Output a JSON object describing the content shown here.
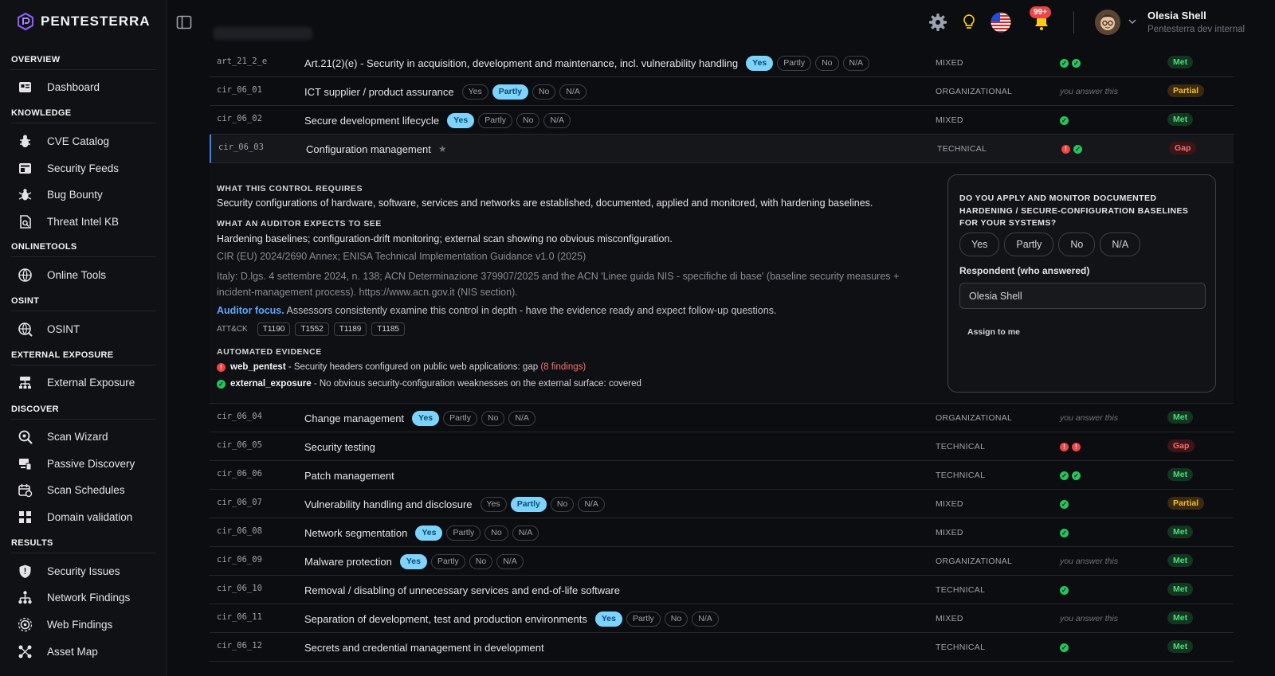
{
  "app": {
    "name": "PENTESTERRA"
  },
  "sidebar": {
    "sections": [
      {
        "title": "OVERVIEW",
        "items": [
          {
            "label": "Dashboard",
            "icon": "dashboard-icon"
          }
        ]
      },
      {
        "title": "KNOWLEDGE",
        "items": [
          {
            "label": "CVE Catalog",
            "icon": "bug-icon"
          },
          {
            "label": "Security Feeds",
            "icon": "news-icon"
          },
          {
            "label": "Bug Bounty",
            "icon": "bug-bounty-icon"
          },
          {
            "label": "Threat Intel KB",
            "icon": "document-search-icon"
          }
        ]
      },
      {
        "title": "ONLINETOOLS",
        "items": [
          {
            "label": "Online Tools",
            "icon": "globe-icon"
          }
        ]
      },
      {
        "title": "OSINT",
        "items": [
          {
            "label": "OSINT",
            "icon": "osint-globe-icon"
          }
        ]
      },
      {
        "title": "EXTERNAL EXPOSURE",
        "items": [
          {
            "label": "External Exposure",
            "icon": "network-icon"
          }
        ]
      },
      {
        "title": "DISCOVER",
        "items": [
          {
            "label": "Scan Wizard",
            "icon": "radar-icon"
          },
          {
            "label": "Passive Discovery",
            "icon": "devices-icon"
          },
          {
            "label": "Scan Schedules",
            "icon": "calendar-icon"
          },
          {
            "label": "Domain validation",
            "icon": "domain-icon"
          }
        ]
      },
      {
        "title": "RESULTS",
        "items": [
          {
            "label": "Security Issues",
            "icon": "shield-icon"
          },
          {
            "label": "Network Findings",
            "icon": "tree-icon"
          },
          {
            "label": "Web Findings",
            "icon": "web-icon"
          },
          {
            "label": "Asset Map",
            "icon": "map-icon"
          }
        ]
      }
    ]
  },
  "topbar": {
    "notifications": "99+",
    "user": {
      "name": "Olesia Shell",
      "org": "Pentesterra dev internal"
    },
    "language": "en-US"
  },
  "rows_before": [
    {
      "code": "art_21_2_e",
      "name": "Art.21(2)(e) - Security in acquisition, development and maintenance, incl. vulnerability handling",
      "options": [
        "Yes",
        "Partly",
        "No",
        "N/A"
      ],
      "selected": "Yes",
      "type": "MIXED",
      "evidence": [
        "ok",
        "ok"
      ],
      "answer": "",
      "status": "Met"
    },
    {
      "code": "cir_06_01",
      "name": "ICT supplier / product assurance",
      "options": [
        "Yes",
        "Partly",
        "No",
        "N/A"
      ],
      "selected": "Partly",
      "type": "ORGANIZATIONAL",
      "evidence": [],
      "answer": "you answer this",
      "status": "Partial"
    },
    {
      "code": "cir_06_02",
      "name": "Secure development lifecycle",
      "options": [
        "Yes",
        "Partly",
        "No",
        "N/A"
      ],
      "selected": "Yes",
      "type": "MIXED",
      "evidence": [
        "ok"
      ],
      "answer": "",
      "status": "Met"
    }
  ],
  "active_row": {
    "code": "cir_06_03",
    "name": "Configuration management",
    "star": "★",
    "type": "TECHNICAL",
    "evidence": [
      "bad",
      "ok"
    ],
    "status": "Gap"
  },
  "detail": {
    "requires_title": "WHAT THIS CONTROL REQUIRES",
    "requires": "Security configurations of hardware, software, services and networks are established, documented, applied and monitored, with hardening baselines.",
    "expects_title": "WHAT AN AUDITOR EXPECTS TO SEE",
    "expects": "Hardening baselines; configuration-drift monitoring; external scan showing no obvious misconfiguration.",
    "ref1": "CIR (EU) 2024/2690 Annex; ENISA Technical Implementation Guidance v1.0 (2025)",
    "ref2": "Italy: D.lgs. 4 settembre 2024, n. 138; ACN Determinazione 379907/2025 and the ACN 'Linee guida NIS - specifiche di base' (baseline security measures + incident-management process). https://www.acn.gov.it (NIS section).",
    "focus_label": "Auditor focus.",
    "focus_text": " Assessors consistently examine this control in depth - have the evidence ready and expect follow-up questions.",
    "attack_label": "ATT&CK",
    "techniques": [
      "T1190",
      "T1552",
      "T1189",
      "T1185"
    ],
    "auto_title": "AUTOMATED EVIDENCE",
    "auto": [
      {
        "status": "bad",
        "source": "web_pentest",
        "text": " - Security headers configured on public web applications: gap ",
        "extra": "(8 findings)"
      },
      {
        "status": "ok",
        "source": "external_exposure",
        "text": " - No obvious security-configuration weaknesses on the external surface: covered",
        "extra": ""
      }
    ],
    "card": {
      "question": "DO YOU APPLY AND MONITOR DOCUMENTED HARDENING / SECURE-CONFIGURATION BASELINES FOR YOUR SYSTEMS?",
      "options": [
        "Yes",
        "Partly",
        "No",
        "N/A"
      ],
      "respondent_label": "Respondent (who answered)",
      "respondent_value": "Olesia Shell",
      "assign_label": "Assign to me"
    }
  },
  "rows_after": [
    {
      "code": "cir_06_04",
      "name": "Change management",
      "options": [
        "Yes",
        "Partly",
        "No",
        "N/A"
      ],
      "selected": "Yes",
      "type": "ORGANIZATIONAL",
      "evidence": [],
      "answer": "you answer this",
      "status": "Met"
    },
    {
      "code": "cir_06_05",
      "name": "Security testing",
      "options": [],
      "selected": "",
      "type": "TECHNICAL",
      "evidence": [
        "bad",
        "bad"
      ],
      "answer": "",
      "status": "Gap"
    },
    {
      "code": "cir_06_06",
      "name": "Patch management",
      "options": [],
      "selected": "",
      "type": "TECHNICAL",
      "evidence": [
        "ok",
        "ok"
      ],
      "answer": "",
      "status": "Met"
    },
    {
      "code": "cir_06_07",
      "name": "Vulnerability handling and disclosure",
      "options": [
        "Yes",
        "Partly",
        "No",
        "N/A"
      ],
      "selected": "Partly",
      "type": "MIXED",
      "evidence": [
        "ok"
      ],
      "answer": "",
      "status": "Partial"
    },
    {
      "code": "cir_06_08",
      "name": "Network segmentation",
      "options": [
        "Yes",
        "Partly",
        "No",
        "N/A"
      ],
      "selected": "Yes",
      "type": "MIXED",
      "evidence": [
        "ok"
      ],
      "answer": "",
      "status": "Met"
    },
    {
      "code": "cir_06_09",
      "name": "Malware protection",
      "options": [
        "Yes",
        "Partly",
        "No",
        "N/A"
      ],
      "selected": "Yes",
      "type": "ORGANIZATIONAL",
      "evidence": [],
      "answer": "you answer this",
      "status": "Met"
    },
    {
      "code": "cir_06_10",
      "name": "Removal / disabling of unnecessary services and end-of-life software",
      "options": [],
      "selected": "",
      "type": "TECHNICAL",
      "evidence": [
        "ok"
      ],
      "answer": "",
      "status": "Met"
    },
    {
      "code": "cir_06_11",
      "name": "Separation of development, test and production environments",
      "options": [
        "Yes",
        "Partly",
        "No",
        "N/A"
      ],
      "selected": "Yes",
      "type": "MIXED",
      "evidence": [],
      "answer": "you answer this",
      "status": "Met"
    },
    {
      "code": "cir_06_12",
      "name": "Secrets and credential management in development",
      "options": [],
      "selected": "",
      "type": "TECHNICAL",
      "evidence": [
        "ok"
      ],
      "answer": "",
      "status": "Met"
    }
  ]
}
